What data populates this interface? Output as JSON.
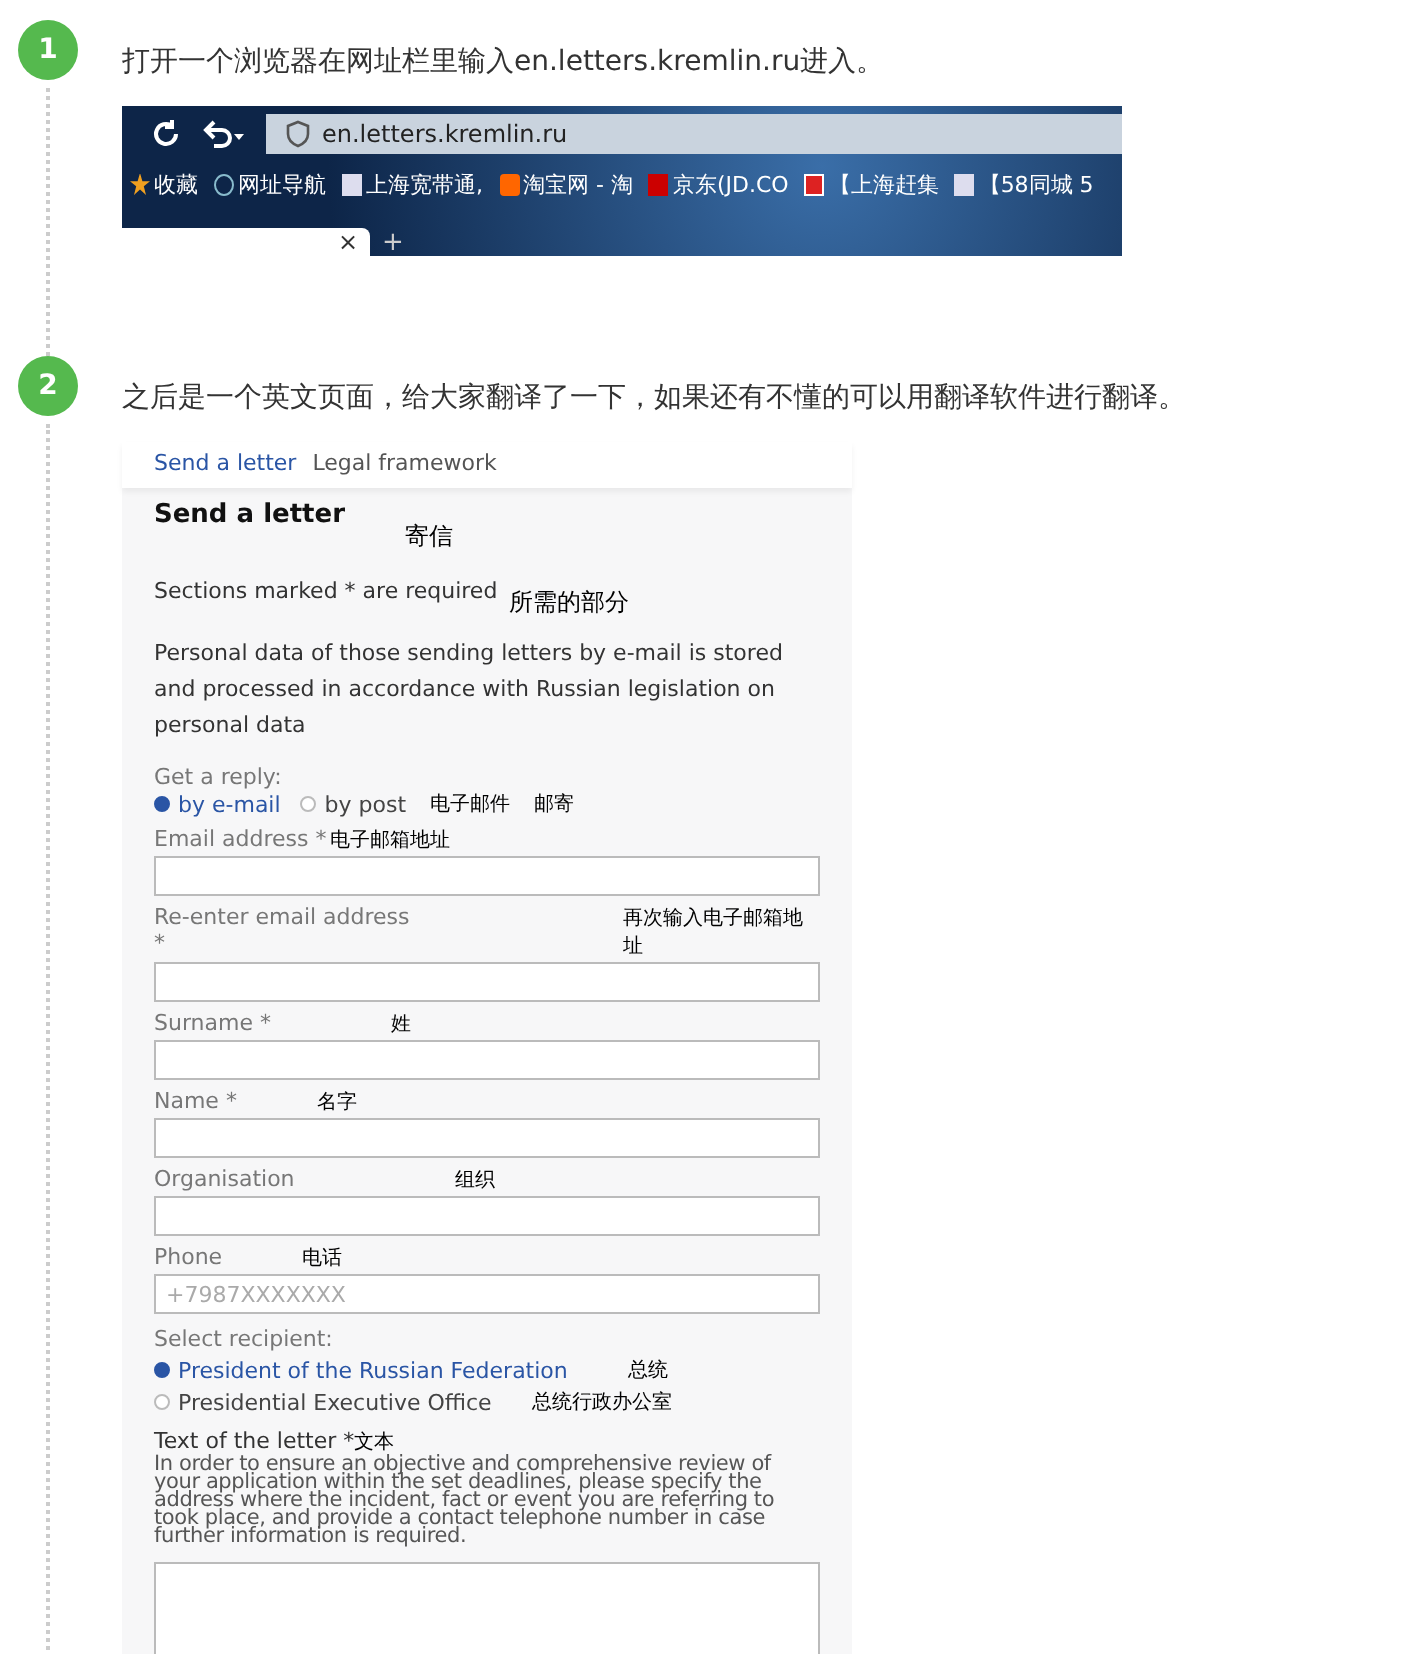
{
  "steps": [
    {
      "number": "1",
      "text": "打开一个浏览器在网址栏里输入en.letters.kremlin.ru进入。",
      "kind": "browser"
    },
    {
      "number": "2",
      "text": "之后是一个英文页面，给大家翻译了一下，如果还有不懂的可以用翻译软件进行翻译。",
      "kind": "form"
    }
  ],
  "browser": {
    "address": "en.letters.kremlin.ru",
    "bookmarks": [
      {
        "label": "收藏",
        "kind": "star"
      },
      {
        "label": "网址导航",
        "kind": "globe"
      },
      {
        "label": "上海宽带通,",
        "kind": "page"
      },
      {
        "label": "淘宝网 - 淘",
        "kind": "tao"
      },
      {
        "label": "京东(JD.CO",
        "kind": "jd"
      },
      {
        "label": "【上海赶集",
        "kind": "ganji"
      },
      {
        "label": "【58同城 5",
        "kind": "page"
      }
    ],
    "tab_close": "×",
    "new_tab": "+"
  },
  "form": {
    "nav": [
      {
        "label": "Send a letter",
        "selected": true
      },
      {
        "label": "Legal framework",
        "selected": false
      }
    ],
    "title": "Send a letter",
    "title_note": "寄信",
    "required_text": "Sections marked * are required",
    "required_note": "所需的部分",
    "privacy_text": "Personal data of those sending letters by e-mail is stored and processed in accordance with Russian legislation on personal data",
    "reply_label": "Get a reply:",
    "reply_options": [
      {
        "label": "by e-mail",
        "selected": true
      },
      {
        "label": "by post",
        "selected": false
      }
    ],
    "reply_notes": [
      "电子邮件",
      "邮寄"
    ],
    "fields": [
      {
        "label": "Email address *",
        "note": "电子邮箱地址"
      },
      {
        "label": "Re-enter email address *",
        "note": "再次输入电子邮箱地址"
      },
      {
        "label": "Surname *",
        "note": "姓"
      },
      {
        "label": "Name *",
        "note": "名字"
      },
      {
        "label": "Organisation",
        "note": "组织"
      },
      {
        "label": "Phone",
        "note": "电话",
        "placeholder": "+7987XXXXXXX"
      }
    ],
    "recipient_label": "Select recipient:",
    "recipients": [
      {
        "label": "President of the Russian Federation",
        "note": "总统",
        "selected": true
      },
      {
        "label": "Presidential Executive Office",
        "note": "总统行政办公室",
        "selected": false
      }
    ],
    "letter_label": "Text of the letter *",
    "letter_note": "文本",
    "letter_hint": "In order to ensure an objective and comprehensive review of your application within the set deadlines, please specify the address where the incident, fact or event you are referring to took place, and provide a contact telephone number in case further information is required."
  }
}
